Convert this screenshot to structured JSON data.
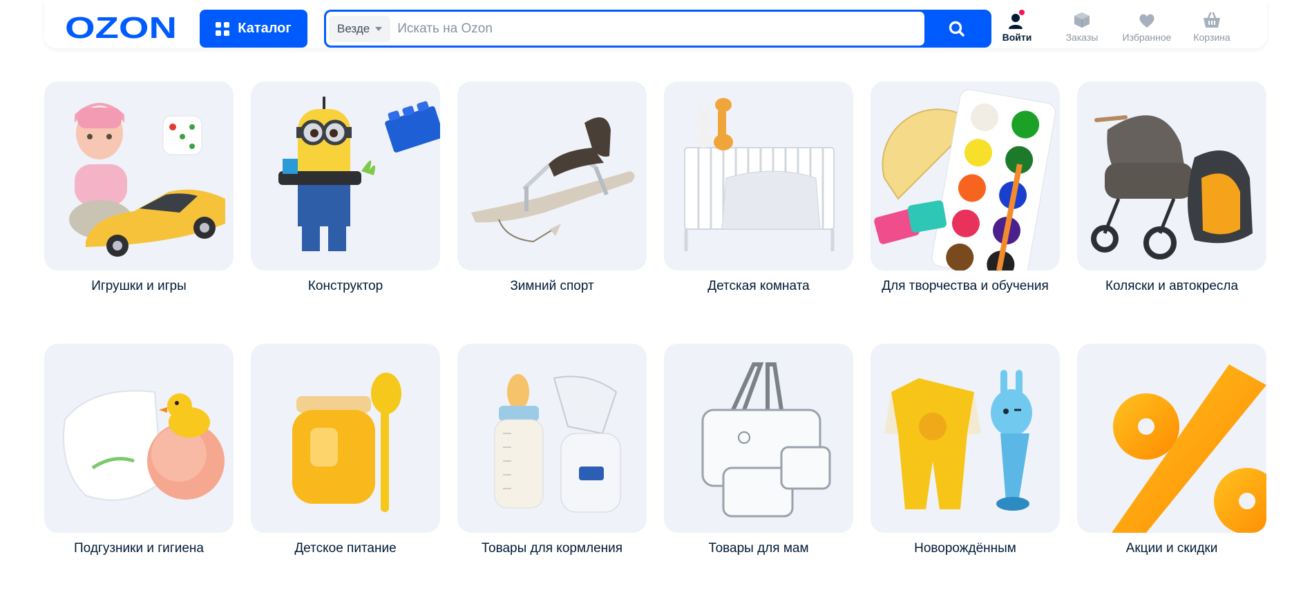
{
  "header": {
    "logo_text": "OZON",
    "catalog_label": "Каталог",
    "search": {
      "scope": "Везде",
      "placeholder": "Искать на Ozon"
    },
    "actions": [
      {
        "label": "Войти",
        "icon": "user-icon"
      },
      {
        "label": "Заказы",
        "icon": "box-icon"
      },
      {
        "label": "Избранное",
        "icon": "heart-icon"
      },
      {
        "label": "Корзина",
        "icon": "basket-icon"
      }
    ]
  },
  "categories": [
    {
      "label": "Игрушки и игры",
      "image": "doll-toy-car"
    },
    {
      "label": "Конструктор",
      "image": "lego-minion"
    },
    {
      "label": "Зимний спорт",
      "image": "snow-sled"
    },
    {
      "label": "Детская комната",
      "image": "baby-crib"
    },
    {
      "label": "Для творчества и обучения",
      "image": "paints-protractor"
    },
    {
      "label": "Коляски и автокресла",
      "image": "stroller-carseat"
    },
    {
      "label": "Подгузники и гигиена",
      "image": "diaper-duck"
    },
    {
      "label": "Детское питание",
      "image": "baby-food-jar"
    },
    {
      "label": "Товары для кормления",
      "image": "bottle-breast-pump"
    },
    {
      "label": "Товары для мам",
      "image": "clear-bags"
    },
    {
      "label": "Новорождённым",
      "image": "romper-rattle"
    },
    {
      "label": "Акции и скидки",
      "image": "percent-sign"
    }
  ],
  "colors": {
    "brand": "#005bff",
    "card_bg": "#eff2f8",
    "text": "#001a34",
    "muted": "#8c96a3",
    "badge": "#f91155"
  }
}
